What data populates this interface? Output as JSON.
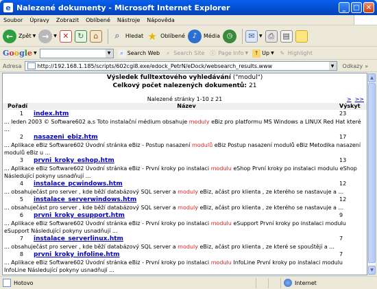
{
  "window": {
    "title": "Nalezené dokumenty - Microsoft Internet Explorer",
    "icon_letter": "e"
  },
  "menu": [
    "Soubor",
    "Úpravy",
    "Zobrazit",
    "Oblíbené",
    "Nástroje",
    "Nápověda"
  ],
  "toolbar": {
    "back": "Zpět",
    "search": "Hledat",
    "favorites": "Oblíbené",
    "media": "Média"
  },
  "googlebar": {
    "logo": [
      "G",
      "o",
      "o",
      "g",
      "l",
      "e"
    ],
    "search_web": "Search Web",
    "search_site": "Search Site",
    "page_info": "Page Info",
    "up": "Up",
    "highlight": "Highlight"
  },
  "address": {
    "label": "Adresa",
    "url": "http://192.168.1.185/scripts/602cgi8.exe/edock_PetrN/eDock/websearch_results.www",
    "links": "Odkazy"
  },
  "results": {
    "heading_bold": "Výsledek fulltextového vyhledávání",
    "heading_query": " (\"modul\")",
    "total_label": "Celkový počet nalezených dokumentů: ",
    "total": "21",
    "pager": "Nalezené stránky 1-10 z 21",
    "next": ">",
    "last": ">>",
    "col_order": "Pořadí",
    "col_name": "Název",
    "col_count": "Výskyt",
    "items": [
      {
        "num": "1",
        "name": "index.htm",
        "count": "23",
        "pre": "... leden 2003 © Software602 a.s Toto instalační médium obsahuje ",
        "hl": "moduly",
        "post": " eBiz pro platformu MS Windows a LINUX Red Hat které ..."
      },
      {
        "num": "2",
        "name": "nasazeni_ebiz.htm",
        "count": "17",
        "pre": "... Aplikace eBiz Software602 Úvodní stránka eBiz - Postup nasazení ",
        "hl": "modulů",
        "post": " eBiz Postup nasazení modulů eBiz Metodika nasazení modulů eBiz u ..."
      },
      {
        "num": "3",
        "name": "prvni_kroky_eshop.htm",
        "count": "13",
        "pre": "... Aplikace eBiz Software602 Úvodní stránka eBiz - První kroky po instalaci ",
        "hl": "modulu",
        "post": " eShop První kroky po instalaci modulu eShop Následující pokyny usnadňují ..."
      },
      {
        "num": "4",
        "name": "instalace_pcwindows.htm",
        "count": "12",
        "pre": "... obsahuječást pro server , kde běží databázový SQL server a ",
        "hl": "moduly",
        "post": " eBiz, ačást pro klienta , ze kterého se nastavuje a ..."
      },
      {
        "num": "5",
        "name": "instalace_serverwindows.htm",
        "count": "12",
        "pre": "... obsahuječást pro server , kde běží databázový SQL server a ",
        "hl": "moduly",
        "post": " eBiz, ačást pro klienta , ze kterého se nastavuje a ..."
      },
      {
        "num": "6",
        "name": "prvni_kroky_esupport.htm",
        "count": "9",
        "pre": "... Aplikace eBiz Software602 Úvodní stránka eBiz - První kroky po instalaci ",
        "hl": "modulu",
        "post": " eSupport První kroky po instalaci modulu eSupport Následující pokyny usnadňují ..."
      },
      {
        "num": "7",
        "name": "instalace_serverlinux.htm",
        "count": "7",
        "pre": "... obsahuječást pro server , kde běží databázový SQL server a ",
        "hl": "moduly",
        "post": " eBiz, ačást pro klienta , ze které se spouštějí a ..."
      },
      {
        "num": "8",
        "name": "prvni_kroky_infoline.htm",
        "count": "7",
        "pre": "... Aplikace eBiz Software602 Úvodní stránka eBiz - První kroky po instalaci ",
        "hl": "modulu",
        "post": " InfoLine První kroky po instalaci modulu InfoLine Následující pokyny usnadňují ..."
      }
    ]
  },
  "status": {
    "left": "Hotovo",
    "zone": "Internet"
  }
}
